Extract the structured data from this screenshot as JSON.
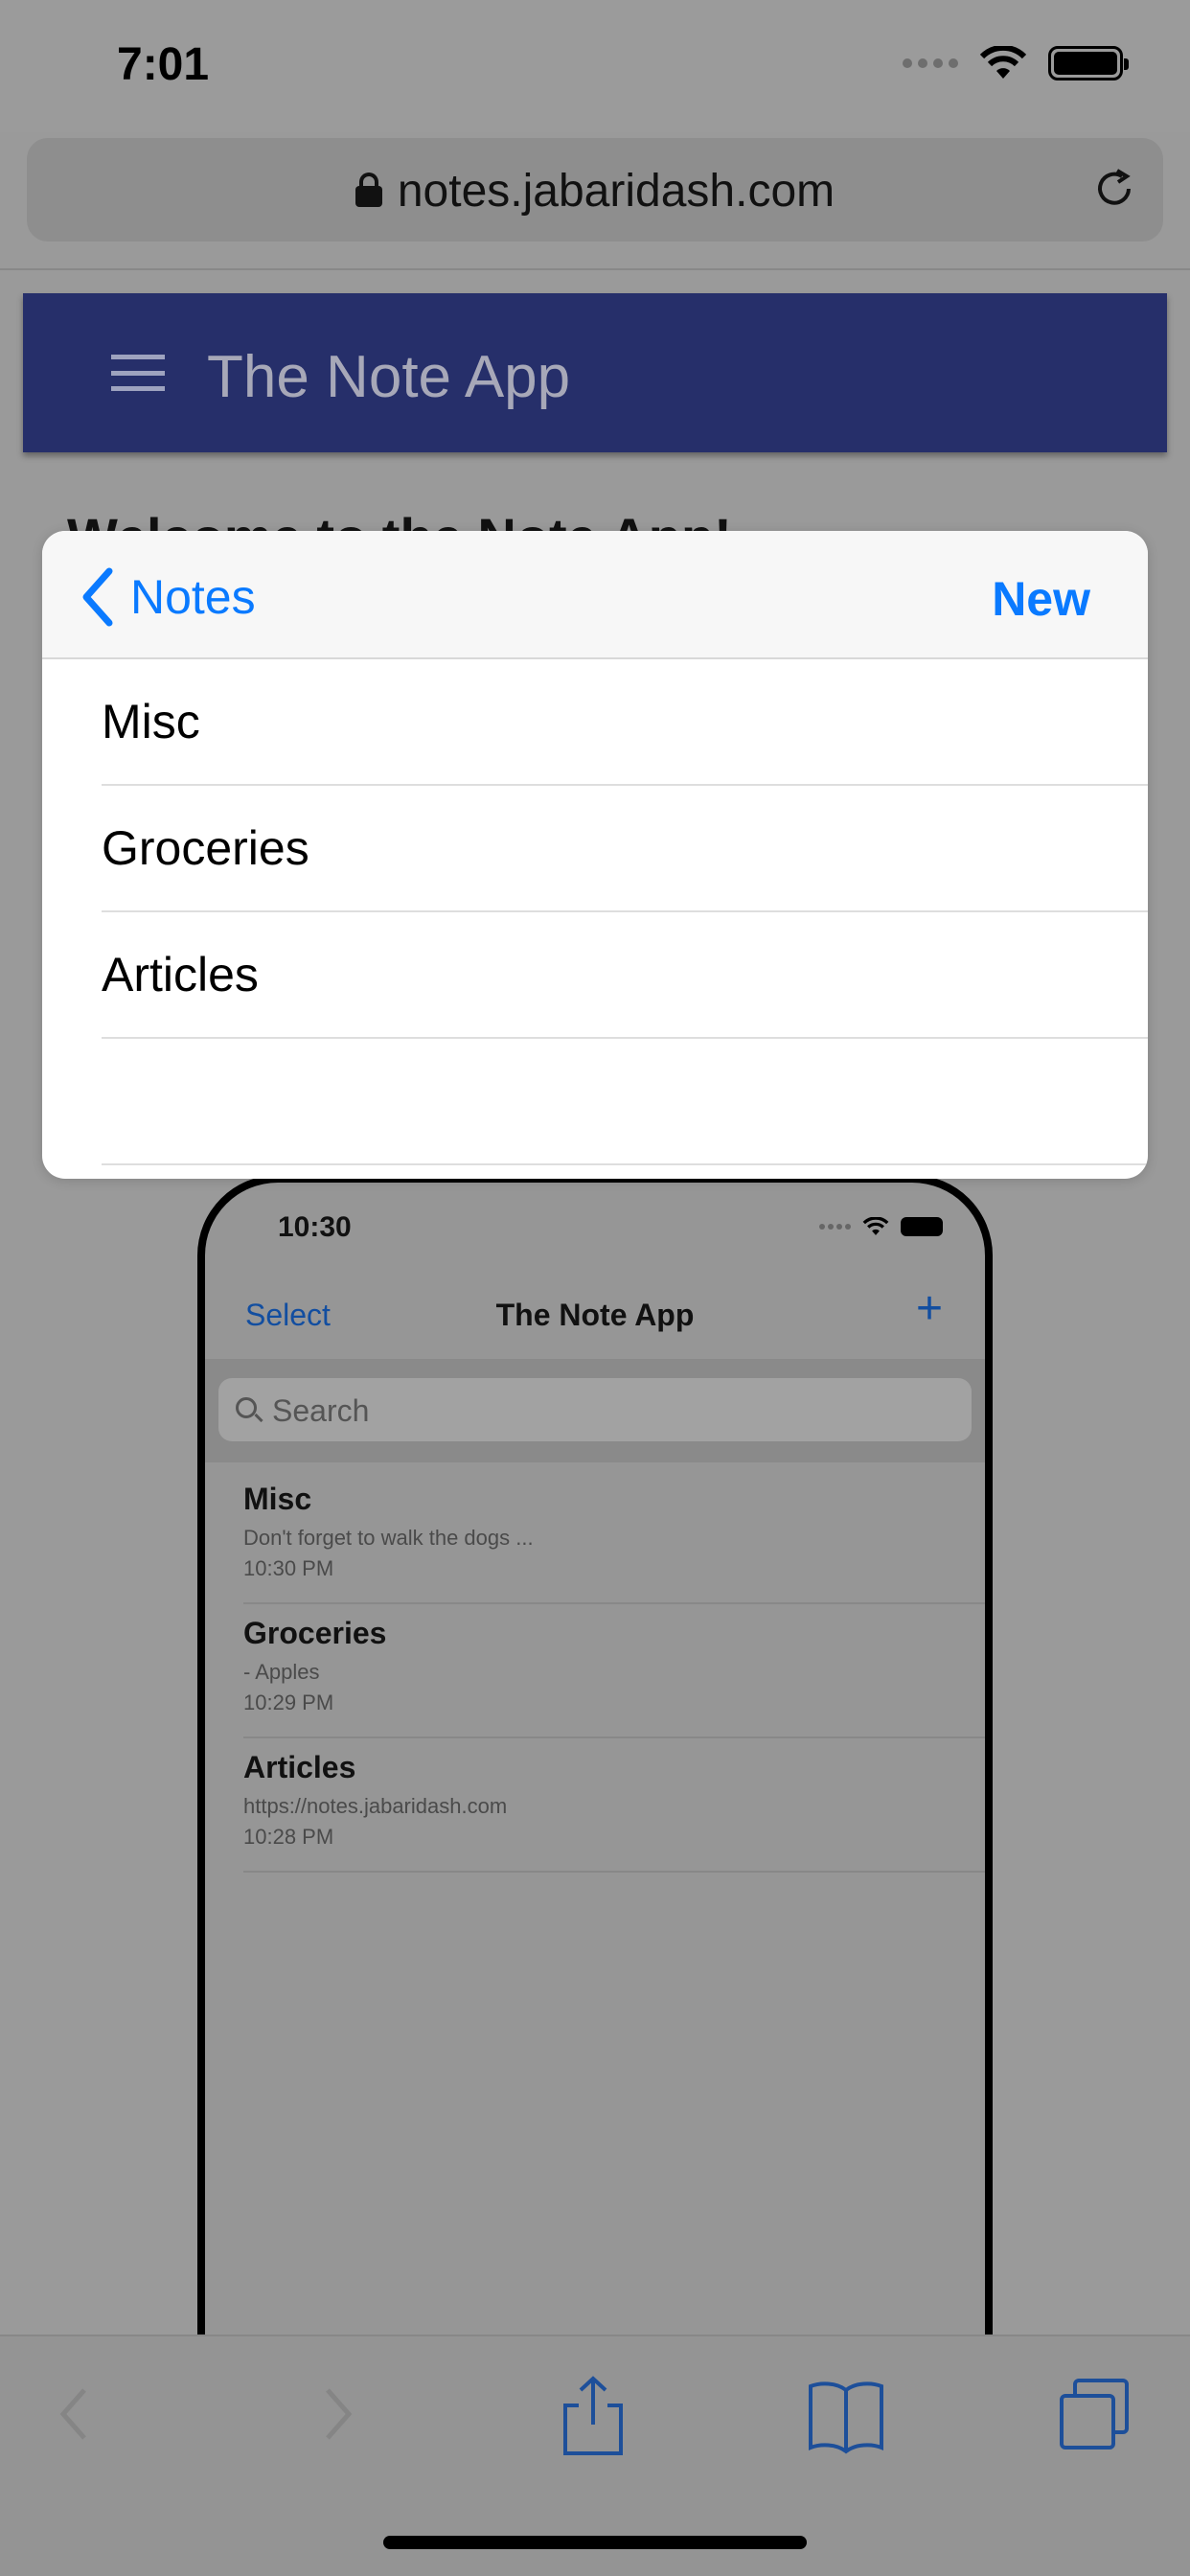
{
  "status_bar": {
    "time": "7:01"
  },
  "browser": {
    "url": "notes.jabaridash.com"
  },
  "page": {
    "app_bar_title": "The Note App",
    "heading": "Welcome to the Note App!"
  },
  "phone_preview": {
    "time": "10:30",
    "select_label": "Select",
    "title": "The Note App",
    "add_label": "+",
    "search_placeholder": "Search",
    "notes": [
      {
        "title": "Misc",
        "preview": "Don't forget to walk the dogs ...",
        "time": "10:30 PM"
      },
      {
        "title": "Groceries",
        "preview": "- Apples",
        "time": "10:29 PM"
      },
      {
        "title": "Articles",
        "preview": "https://notes.jabaridash.com",
        "time": "10:28 PM"
      }
    ]
  },
  "modal": {
    "back_label": "Notes",
    "new_label": "New",
    "folders": [
      "Misc",
      "Groceries",
      "Articles",
      ""
    ]
  },
  "colors": {
    "accent": "#0a7aff",
    "app_bar": "#262f6a"
  }
}
